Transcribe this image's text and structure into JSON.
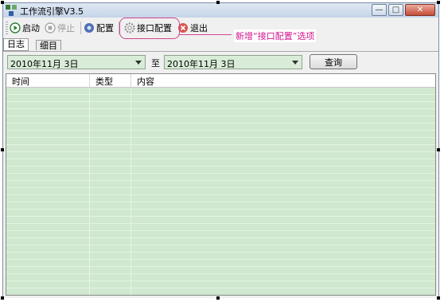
{
  "window": {
    "title": "工作流引擎V3.5",
    "controls": {
      "minimize": "—",
      "maximize": "□",
      "close": "✕"
    }
  },
  "toolbar": {
    "start": "启动",
    "stop": "停止",
    "config": "配置",
    "interface_config": "接口配置",
    "exit": "退出"
  },
  "annotation": {
    "text": "新增“接口配置”选项",
    "color": "#d1168f"
  },
  "tabs": {
    "log": "日志",
    "detail": "细目"
  },
  "filter": {
    "from_date": "2010年11月  3日",
    "to_label": "至",
    "to_date": "2010年11月  3日",
    "query_button": "查询"
  },
  "grid": {
    "columns": [
      "时间",
      "类型",
      "内容"
    ]
  },
  "colors": {
    "grid_row": "#cfe8cf",
    "accent_pink": "#d1468f"
  }
}
